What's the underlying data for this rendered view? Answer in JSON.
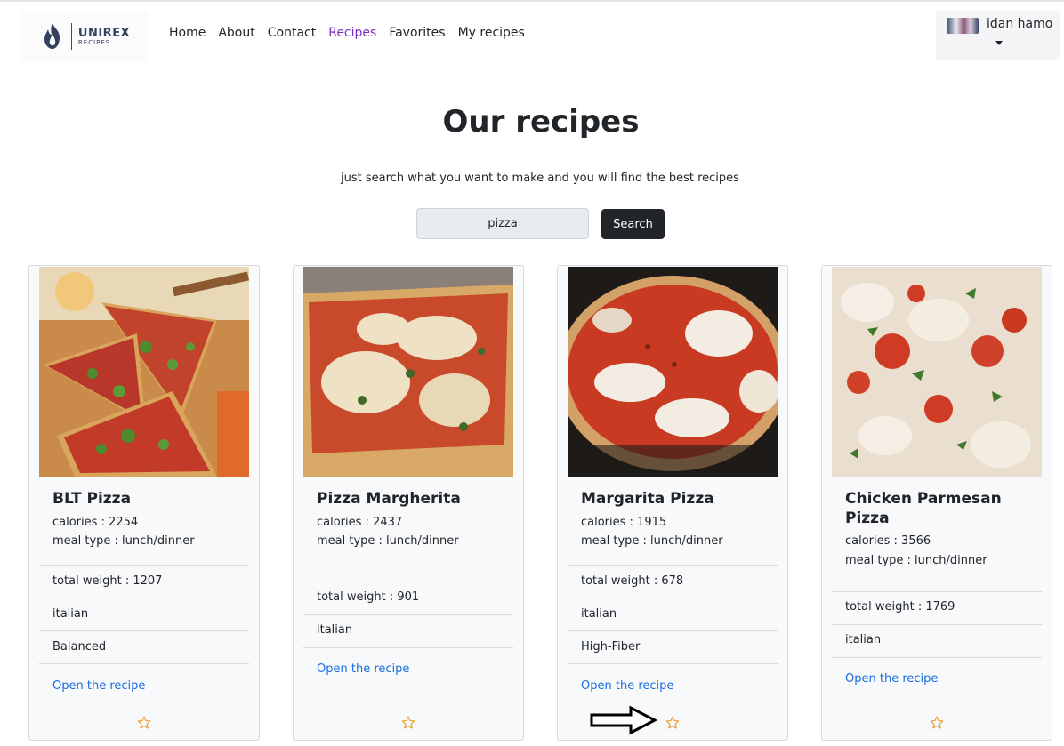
{
  "brand": {
    "name": "UNIREX",
    "tagline": "RECIPES"
  },
  "nav": {
    "items": [
      {
        "label": "Home"
      },
      {
        "label": "About"
      },
      {
        "label": "Contact"
      },
      {
        "label": "Recipes",
        "active": true
      },
      {
        "label": "Favorites"
      },
      {
        "label": "My recipes"
      }
    ]
  },
  "user": {
    "name": "idan hamo"
  },
  "hero": {
    "title": "Our recipes",
    "subtitle": "just search what you want to make and you will find the best recipes"
  },
  "search": {
    "value": "pizza",
    "button_label": "Search"
  },
  "recipes": [
    {
      "name": "BLT Pizza",
      "calories": "calories : 2254",
      "meal_type": "meal type : lunch/dinner",
      "total_weight": "total weight : 1207",
      "cuisine": "italian",
      "diet": "Balanced",
      "link_label": "Open the recipe"
    },
    {
      "name": "Pizza Margherita",
      "calories": "calories : 2437",
      "meal_type": "meal type : lunch/dinner",
      "total_weight": "total weight : 901",
      "cuisine": "italian",
      "diet": "",
      "link_label": "Open the recipe"
    },
    {
      "name": "Margarita Pizza",
      "calories": "calories : 1915",
      "meal_type": "meal type : lunch/dinner",
      "total_weight": "total weight : 678",
      "cuisine": "italian",
      "diet": "High-Fiber",
      "link_label": "Open the recipe"
    },
    {
      "name": "Chicken Parmesan Pizza",
      "calories": "calories : 3566",
      "meal_type": "meal type : lunch/dinner",
      "total_weight": "total weight : 1769",
      "cuisine": "italian",
      "diet": "",
      "link_label": "Open the recipe"
    }
  ],
  "colors": {
    "accent": "#7b2fbe",
    "link": "#1a6de0",
    "star": "#f0a030",
    "button": "#212529"
  },
  "icons": {
    "favorite": "star-outline-icon",
    "annotation": "right-arrow-icon",
    "menu": "caret-down-icon"
  }
}
